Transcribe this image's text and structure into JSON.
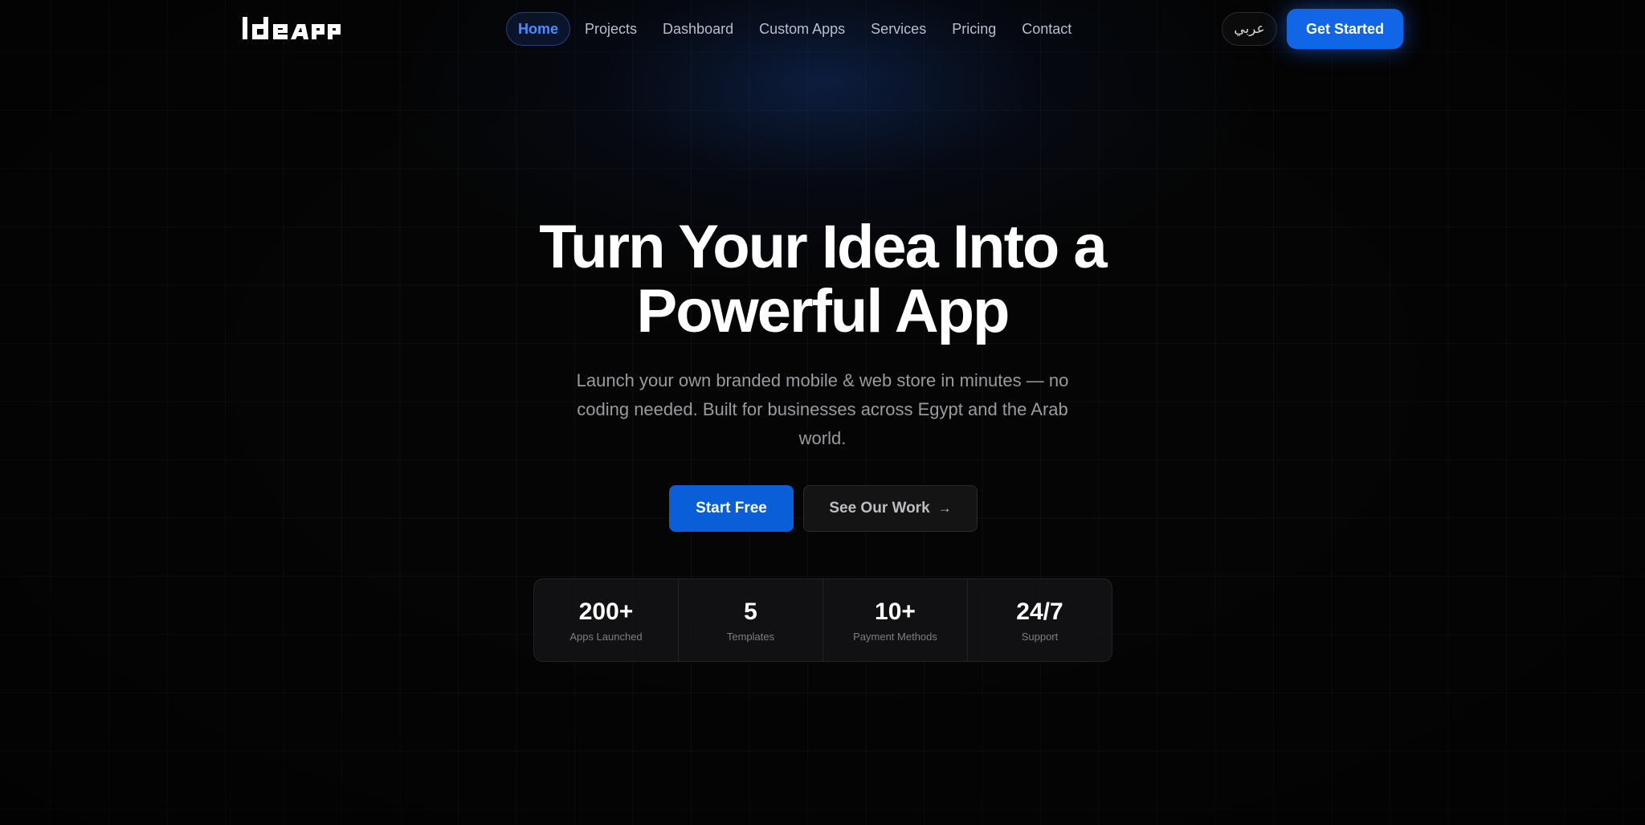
{
  "brand": {
    "logo_text": "IdeApp"
  },
  "nav": {
    "items": [
      {
        "label": "Home",
        "active": true
      },
      {
        "label": "Projects"
      },
      {
        "label": "Dashboard"
      },
      {
        "label": "Custom Apps"
      },
      {
        "label": "Services"
      },
      {
        "label": "Pricing"
      },
      {
        "label": "Contact"
      }
    ]
  },
  "header": {
    "language_label": "عربي",
    "cta_label": "Get Started"
  },
  "hero": {
    "title_line1": "Turn Your Idea Into a",
    "title_line2": "Powerful App",
    "subtitle": "Launch your own branded mobile & web store in minutes — no coding needed. Built for businesses across Egypt and the Arab world.",
    "primary_button": "Start Free",
    "secondary_button": "See Our Work",
    "secondary_icon": "arrow-right-icon"
  },
  "stats": [
    {
      "value": "200+",
      "label": "Apps Launched"
    },
    {
      "value": "5",
      "label": "Templates"
    },
    {
      "value": "10+",
      "label": "Payment Methods"
    },
    {
      "value": "24/7",
      "label": "Support"
    }
  ],
  "colors": {
    "accent": "#1066e6",
    "nav_active": "#4a8dff",
    "background": "#050505"
  }
}
